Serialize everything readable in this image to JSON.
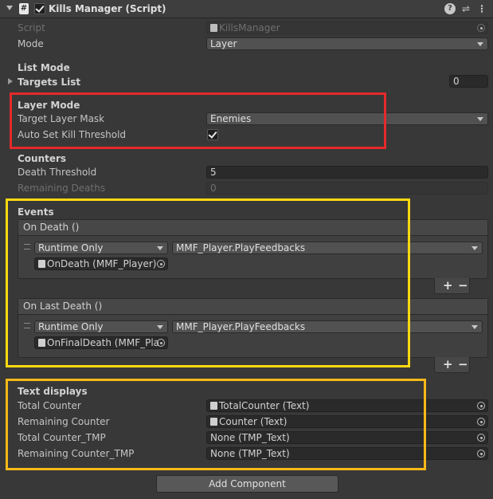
{
  "header": {
    "title": "Kills Manager (Script)",
    "enabled": true,
    "icons": [
      "help-icon",
      "settings-sliders-icon",
      "more-icon"
    ]
  },
  "fields": {
    "script": {
      "label": "Script",
      "value": "KillsManager"
    },
    "mode": {
      "label": "Mode",
      "value": "Layer"
    }
  },
  "list_mode": {
    "heading": "List Mode",
    "targets_label": "Targets List",
    "targets_count": "0"
  },
  "layer_mode": {
    "heading": "Layer Mode",
    "target_layer_mask_label": "Target Layer Mask",
    "target_layer_mask_value": "Enemies",
    "auto_set_label": "Auto Set Kill Threshold",
    "auto_set_checked": true
  },
  "counters": {
    "heading": "Counters",
    "death_threshold_label": "Death Threshold",
    "death_threshold_value": "5",
    "remaining_deaths_label": "Remaining Deaths",
    "remaining_deaths_value": "0"
  },
  "events": {
    "heading": "Events",
    "on_death": {
      "title": "On Death ()",
      "runtime": "Runtime Only",
      "function": "MMF_Player.PlayFeedbacks",
      "object": "OnDeath (MMF_Player)"
    },
    "on_last_death": {
      "title": "On Last Death ()",
      "runtime": "Runtime Only",
      "function": "MMF_Player.PlayFeedbacks",
      "object": "OnFinalDeath (MMF_Pla"
    },
    "plus": "+",
    "minus": "−"
  },
  "text_displays": {
    "heading": "Text displays",
    "total_counter_label": "Total Counter",
    "total_counter_value": "TotalCounter (Text)",
    "remaining_counter_label": "Remaining Counter",
    "remaining_counter_value": "Counter (Text)",
    "total_counter_tmp_label": "Total Counter_TMP",
    "total_counter_tmp_value": "None (TMP_Text)",
    "remaining_counter_tmp_label": "Remaining Counter_TMP",
    "remaining_counter_tmp_value": "None (TMP_Text)"
  },
  "add_component": "Add Component",
  "annotation_colors": {
    "red": "#e52a2a",
    "yellow": "#fcd812",
    "orange": "#f7b918"
  }
}
